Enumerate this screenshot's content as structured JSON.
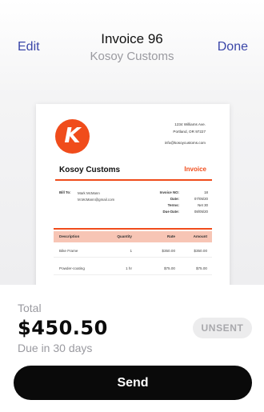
{
  "nav": {
    "left_label": "Edit",
    "title": "Invoice 96",
    "subtitle": "Kosoy Customs",
    "right_label": "Done"
  },
  "invoice": {
    "logo_letter": "K",
    "address_line1": "1234 Williams Ave.",
    "address_line2": "Portland, OR 97227",
    "website": "info@kosoycustoms.com",
    "company": "Kosoy Customs",
    "doc_type": "Invoice",
    "bill_to_label": "Bill To:",
    "bill_to_name": "Mark McMann",
    "bill_to_email": "M.McMann@gmail.com",
    "meta": [
      {
        "label": "Invoice NO:",
        "value": "18"
      },
      {
        "label": "Date:",
        "value": "07/05/20"
      },
      {
        "label": "Terms:",
        "value": "Net 30"
      },
      {
        "label": "Due Date:",
        "value": "08/05/20"
      }
    ],
    "columns": [
      "Description",
      "Quantity",
      "Rate",
      "Amount"
    ],
    "rows": [
      {
        "description": "Bike Frame",
        "quantity": "1",
        "rate": "$350.00",
        "amount": "$350.00"
      },
      {
        "description": "Powder-coating",
        "quantity": "1 hr",
        "rate": "$75.00",
        "amount": "$75.00"
      }
    ]
  },
  "summary": {
    "total_label": "Total",
    "total_value": "$450.50",
    "due_text": "Due in 30 days",
    "status_badge": "UNSENT"
  },
  "actions": {
    "send_label": "Send"
  },
  "colors": {
    "accent": "#f04c1b",
    "link": "#3a46a8",
    "button": "#0a0a0a"
  }
}
